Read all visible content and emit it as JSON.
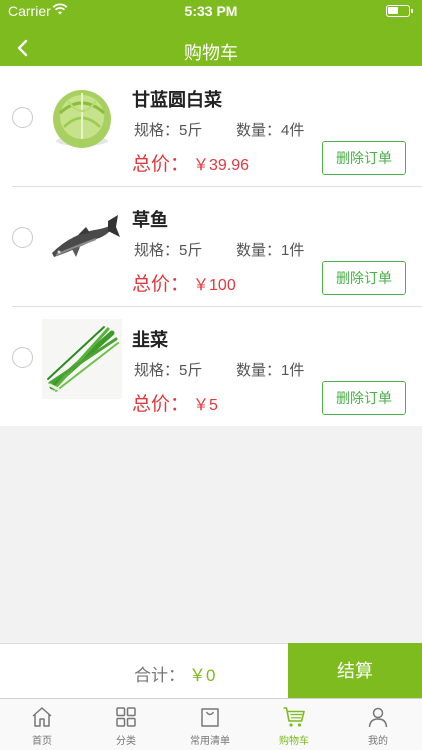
{
  "status_bar": {
    "carrier": "Carrier",
    "time": "5:33 PM"
  },
  "navbar": {
    "title": "购物车"
  },
  "items": [
    {
      "name": "甘蓝圆白菜",
      "spec": "规格：5斤",
      "qty": "数量：4件",
      "total_label": "总价：",
      "price": "￥39.96",
      "delete_label": "删除订单",
      "image": "cabbage"
    },
    {
      "name": "草鱼",
      "spec": "规格：5斤",
      "qty": "数量：1件",
      "total_label": "总价：",
      "price": "￥100",
      "delete_label": "删除订单",
      "image": "fish"
    },
    {
      "name": "韭菜",
      "spec": "规格：5斤",
      "qty": "数量：1件",
      "total_label": "总价：",
      "price": "￥5",
      "delete_label": "删除订单",
      "image": "chives"
    }
  ],
  "checkout": {
    "sum_label": "合计：",
    "sum_value": "￥0",
    "button_label": "结算"
  },
  "tabbar": [
    {
      "label": "首页",
      "icon": "home-icon"
    },
    {
      "label": "分类",
      "icon": "grid-icon"
    },
    {
      "label": "常用清单",
      "icon": "bag-icon"
    },
    {
      "label": "购物车",
      "icon": "cart-icon",
      "active": true
    },
    {
      "label": "我的",
      "icon": "user-icon"
    }
  ],
  "colors": {
    "brand": "#7dbb1e",
    "price": "#e0383f",
    "delete_border": "#4bb049"
  }
}
